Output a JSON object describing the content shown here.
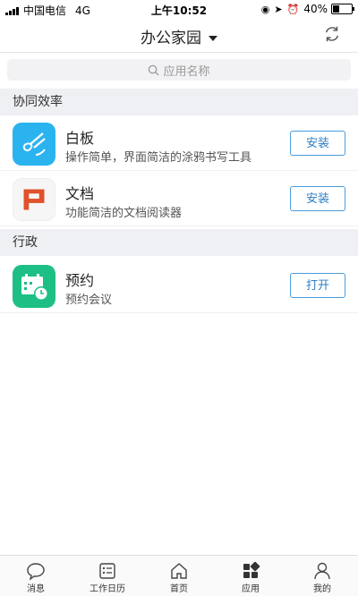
{
  "status": {
    "carrier": "中国电信",
    "network": "4G",
    "time": "上午10:52",
    "battery": "40%",
    "battery_level": 0.4
  },
  "nav": {
    "title": "办公家园"
  },
  "search": {
    "placeholder": "应用名称"
  },
  "sections": [
    {
      "title": "协同效率",
      "apps": [
        {
          "name": "白板",
          "desc": "操作简单，界面简洁的涂鸦书写工具",
          "action": "安装",
          "icon": "whiteboard-icon",
          "color": "#2ab3ef"
        },
        {
          "name": "文档",
          "desc": "功能简洁的文档阅读器",
          "action": "安装",
          "icon": "document-icon",
          "color": "#e0522b"
        }
      ]
    },
    {
      "title": "行政",
      "apps": [
        {
          "name": "预约",
          "desc": "预约会议",
          "action": "打开",
          "icon": "calendar-clock-icon",
          "color": "#1dbf85"
        }
      ]
    }
  ],
  "tabs": [
    {
      "label": "消息",
      "icon": "chat-bubble-icon"
    },
    {
      "label": "工作日历",
      "icon": "calendar-list-icon"
    },
    {
      "label": "首页",
      "icon": "home-icon"
    },
    {
      "label": "应用",
      "icon": "apps-grid-icon",
      "active": true
    },
    {
      "label": "我的",
      "icon": "person-icon"
    }
  ]
}
